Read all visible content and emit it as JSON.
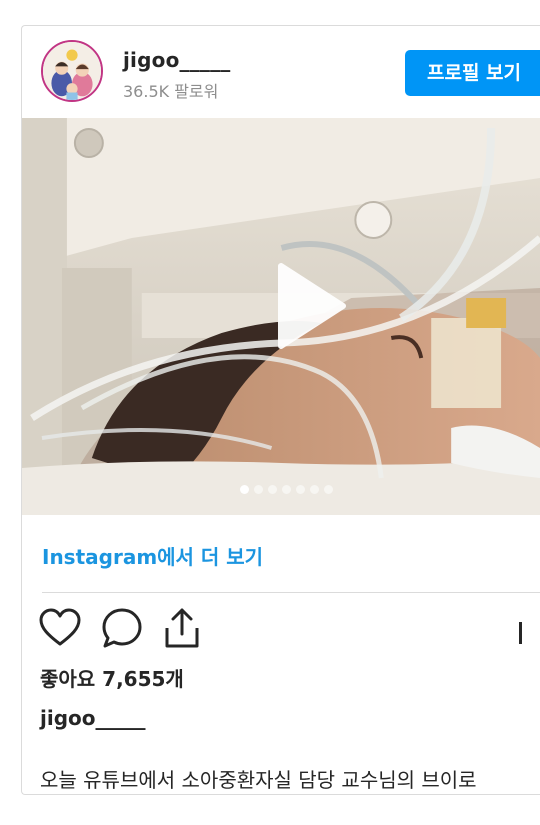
{
  "header": {
    "username": "jigoo_____",
    "followers": "36.5K 팔로워",
    "profile_button": "프로필 보기"
  },
  "media": {
    "type": "video",
    "carousel_count": 7,
    "active_index": 0
  },
  "more_link": "Instagram에서 더 보기",
  "actions": {
    "icons": [
      "heart-icon",
      "comment-icon",
      "share-icon",
      "bookmark-icon"
    ]
  },
  "likes": "좋아요 7,655개",
  "caption": {
    "username": "jigoo_____",
    "text": "오늘 유튜브에서 소아중환자실 담당 교수님의 브이로"
  },
  "colors": {
    "accent": "#0095f6",
    "link": "#1b95e0",
    "text": "#262626",
    "muted": "#8e8e8e",
    "border": "#dbdbdb"
  }
}
